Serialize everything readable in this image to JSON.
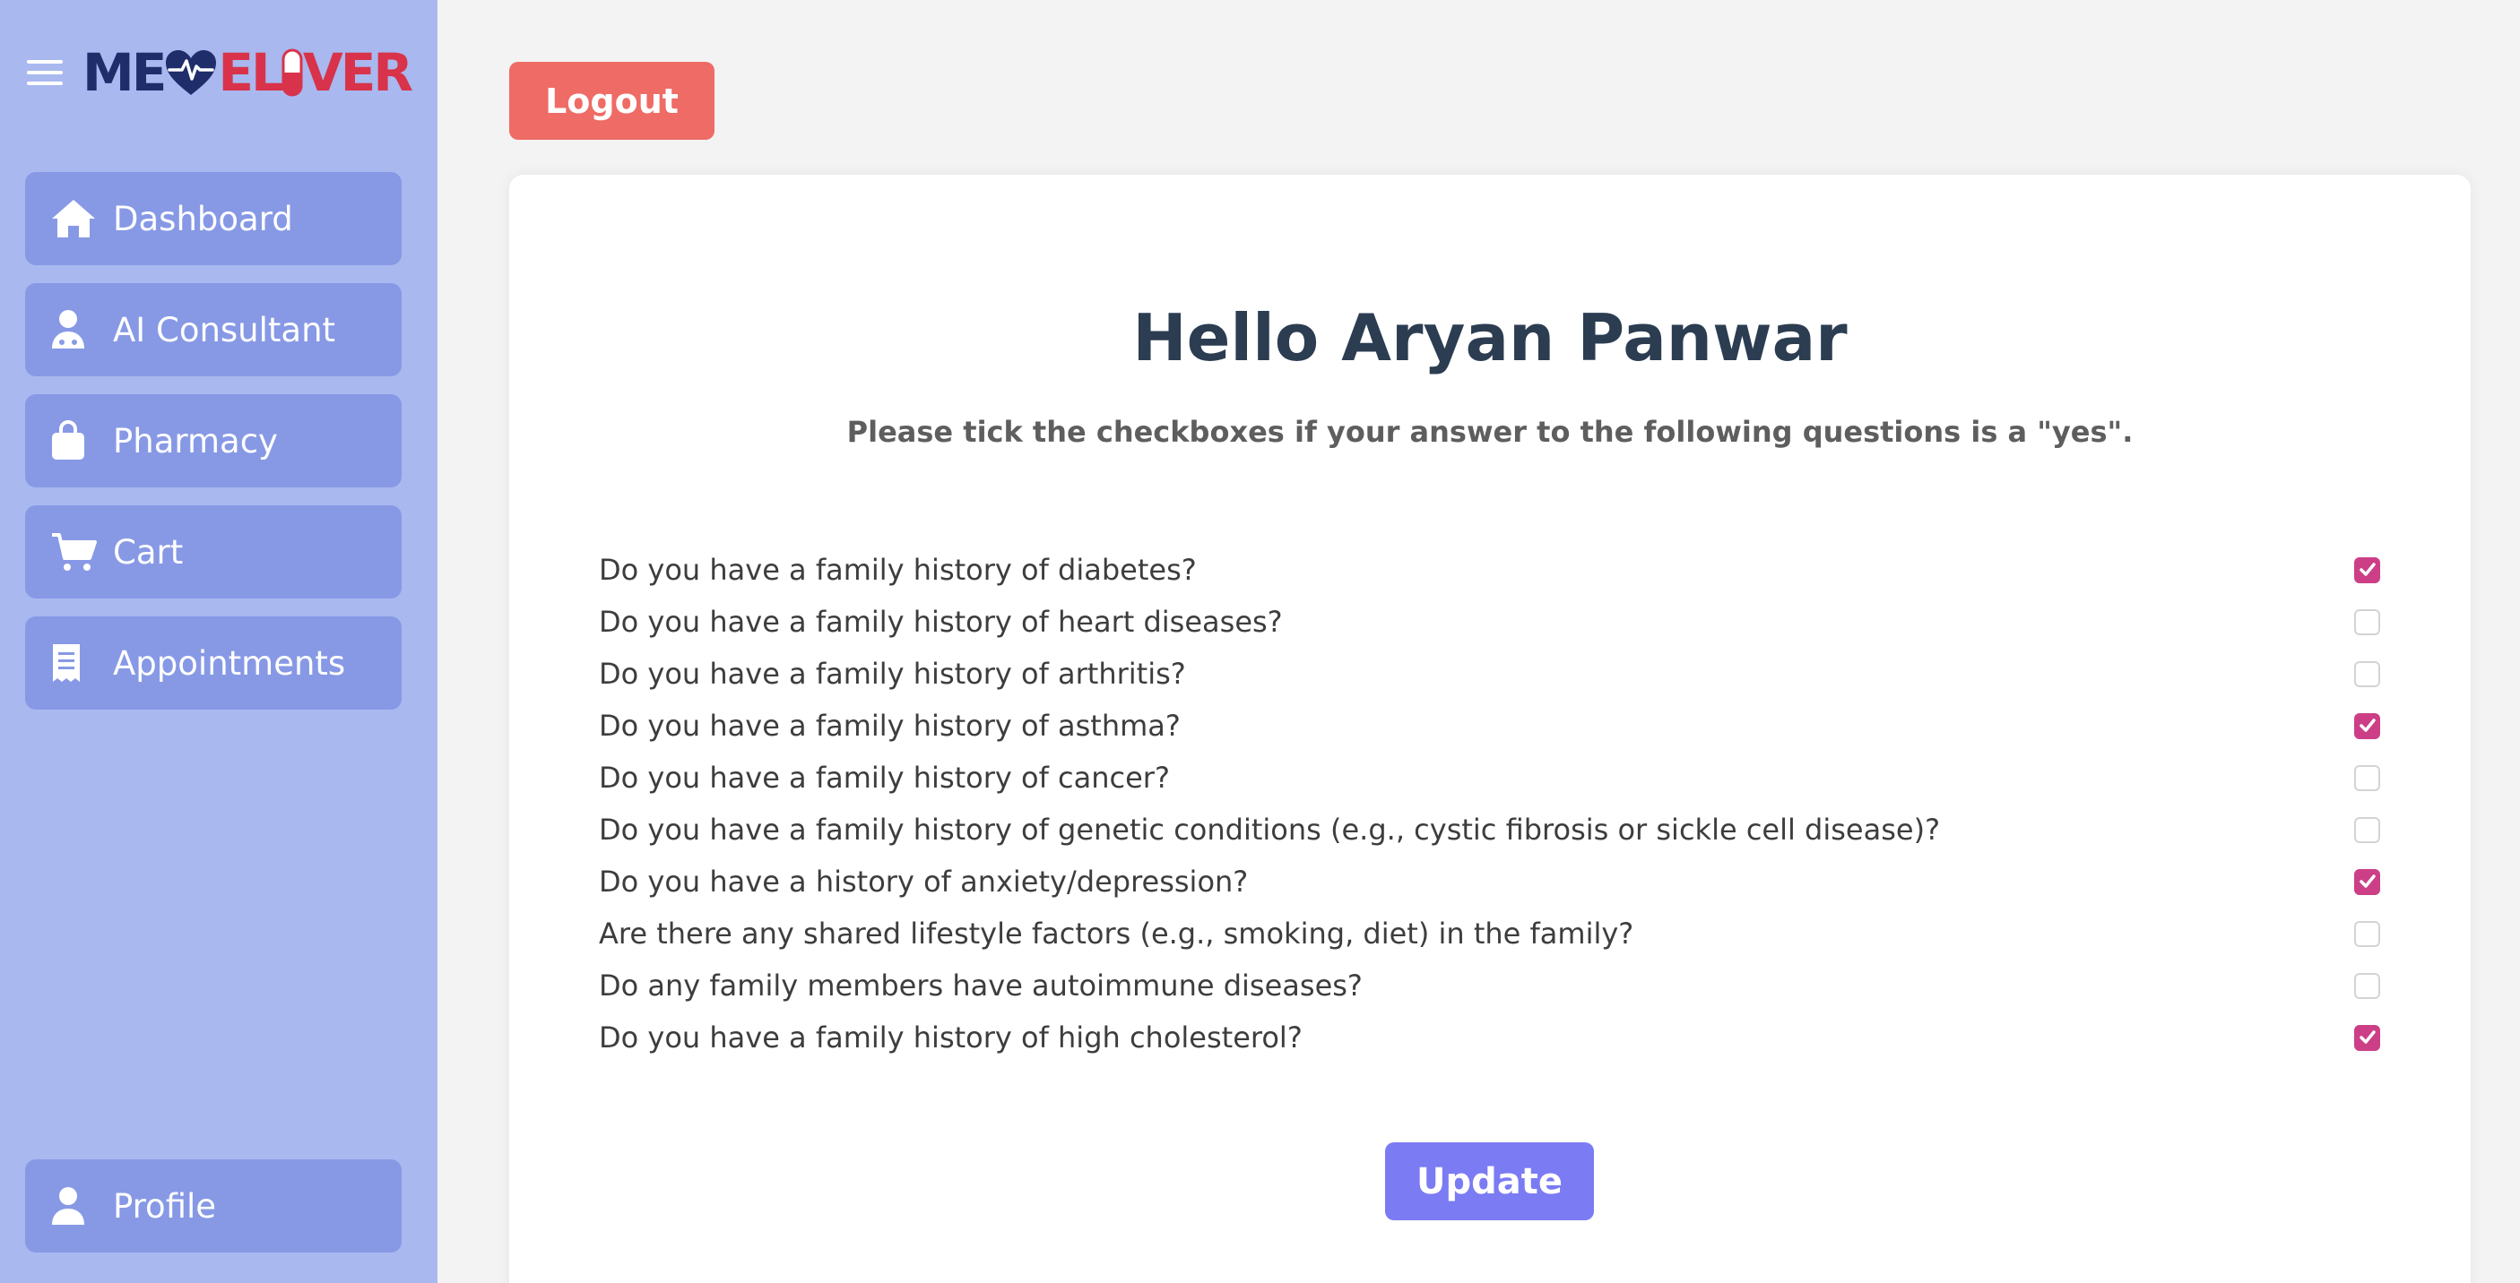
{
  "brand": {
    "part1": "ME",
    "part2": "EL",
    "part3": "VER",
    "colors": {
      "navy": "#1f2d6b",
      "red": "#d8334a"
    }
  },
  "sidebar": {
    "bg_color": "#a9b8ef",
    "item_color": "#8799e5",
    "items": [
      {
        "label": "Dashboard",
        "icon": "home-icon"
      },
      {
        "label": "AI Consultant",
        "icon": "doctor-icon"
      },
      {
        "label": "Pharmacy",
        "icon": "shopping-bag-icon"
      },
      {
        "label": "Cart",
        "icon": "cart-icon"
      },
      {
        "label": "Appointments",
        "icon": "receipt-icon"
      }
    ],
    "profile": {
      "label": "Profile",
      "icon": "user-icon"
    }
  },
  "header": {
    "logout_label": "Logout",
    "logout_color": "#ef6b66"
  },
  "main": {
    "greeting": "Hello Aryan Panwar",
    "instruction": "Please tick the checkboxes if your answer to the following questions is a \"yes\".",
    "questions": [
      {
        "text": "Do you have a family history of diabetes?",
        "checked": true
      },
      {
        "text": "Do you have a family history of heart diseases?",
        "checked": false
      },
      {
        "text": "Do you have a family history of arthritis?",
        "checked": false
      },
      {
        "text": "Do you have a family history of asthma?",
        "checked": true
      },
      {
        "text": "Do you have a family history of cancer?",
        "checked": false
      },
      {
        "text": "Do you have a family history of genetic conditions (e.g., cystic fibrosis or sickle cell disease)?",
        "checked": false
      },
      {
        "text": "Do you have a history of anxiety/depression?",
        "checked": true
      },
      {
        "text": "Are there any shared lifestyle factors (e.g., smoking, diet) in the family?",
        "checked": false
      },
      {
        "text": "Do any family members have autoimmune diseases?",
        "checked": false
      },
      {
        "text": "Do you have a family history of high cholesterol?",
        "checked": true
      }
    ],
    "checkbox_color": "#cc3f87",
    "update_label": "Update",
    "update_color": "#7b7bf4"
  }
}
